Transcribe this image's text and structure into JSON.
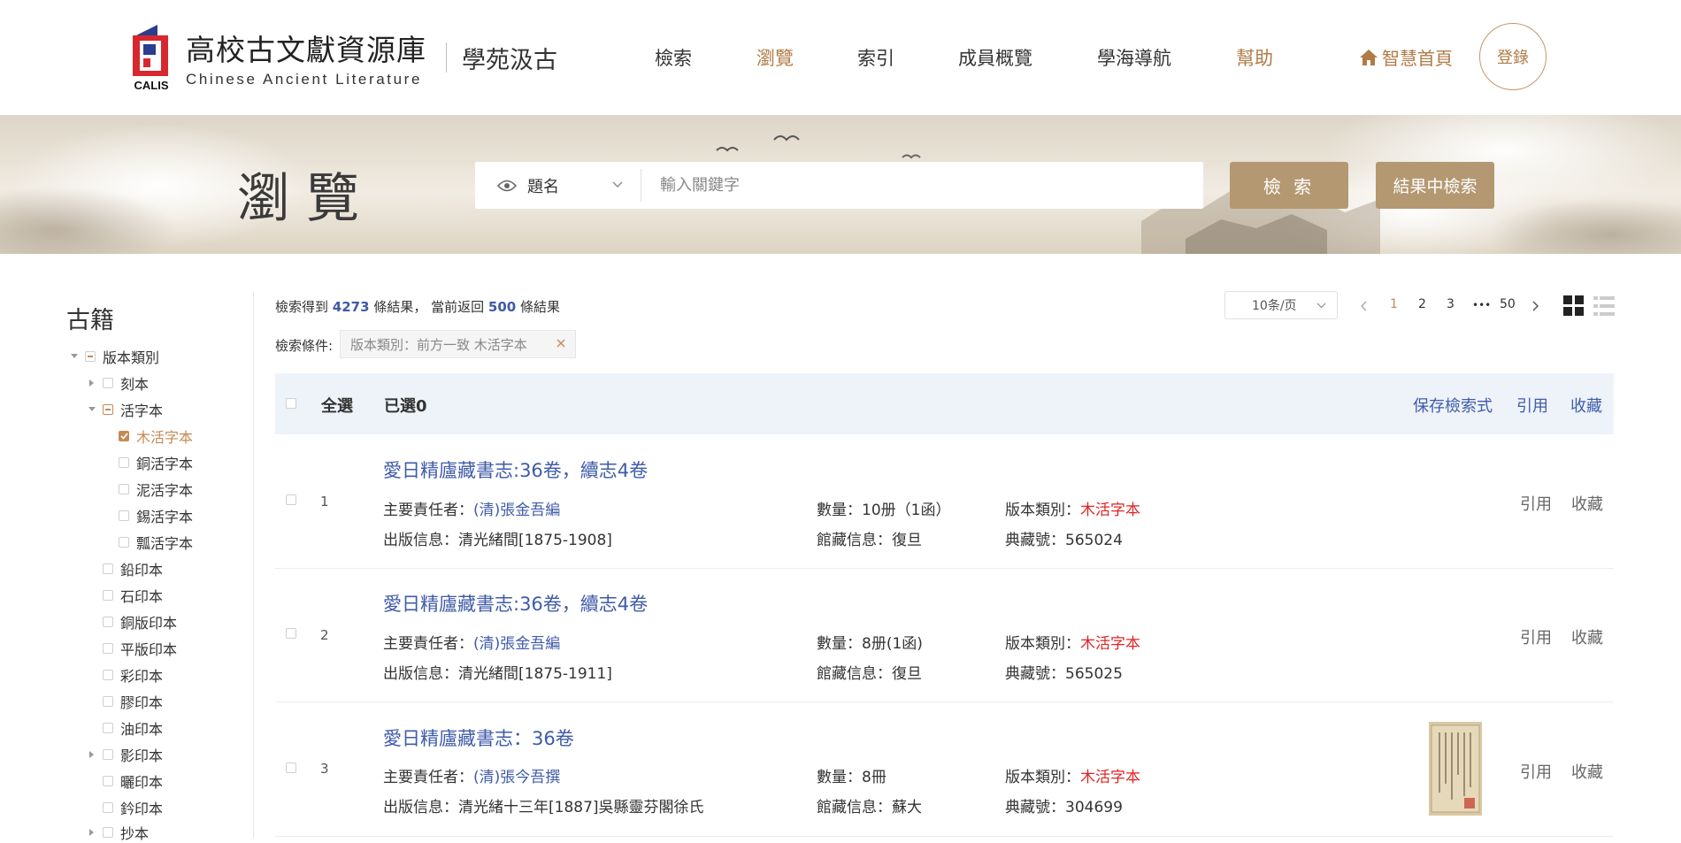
{
  "header": {
    "logo_badge": "CALIS",
    "site_name_cn": "高校古文獻資源庫",
    "site_name_en": "Chinese Ancient Literature",
    "sub_brand": "學苑汲古",
    "nav": [
      "檢索",
      "瀏覽",
      "索引",
      "成員概覽",
      "學海導航",
      "幫助"
    ],
    "home_link": "智慧首頁",
    "login": "登錄",
    "accent": "#b07b45"
  },
  "banner": {
    "title": "瀏覽",
    "search_field": "題名",
    "search_placeholder": "輸入關鍵字",
    "search_button": "檢 索",
    "refine_button": "結果中檢索"
  },
  "sidebar": {
    "title": "古籍",
    "tree": [
      {
        "label": "版本類別",
        "state": "partial"
      },
      {
        "label": "刻本",
        "state": "none"
      },
      {
        "label": "活字本",
        "state": "partial"
      },
      {
        "label": "木活字本",
        "state": "checked"
      },
      {
        "label": "銅活字本",
        "state": "none"
      },
      {
        "label": "泥活字本",
        "state": "none"
      },
      {
        "label": "錫活字本",
        "state": "none"
      },
      {
        "label": "瓢活字本",
        "state": "none"
      },
      {
        "label": "鉛印本",
        "state": "none"
      },
      {
        "label": "石印本",
        "state": "none"
      },
      {
        "label": "銅版印本",
        "state": "none"
      },
      {
        "label": "平版印本",
        "state": "none"
      },
      {
        "label": "彩印本",
        "state": "none"
      },
      {
        "label": "膠印本",
        "state": "none"
      },
      {
        "label": "油印本",
        "state": "none"
      },
      {
        "label": "影印本",
        "state": "none"
      },
      {
        "label": "曬印本",
        "state": "none"
      },
      {
        "label": "鈐印本",
        "state": "none"
      },
      {
        "label": "抄本",
        "state": "none"
      }
    ]
  },
  "results": {
    "summary_prefix": "檢索得到",
    "total": "4273",
    "summary_mid": "條結果， 當前返回",
    "returned": "500",
    "summary_suffix": "條結果",
    "per_page": "10条/页",
    "pages": [
      "1",
      "2",
      "3",
      "•••",
      "50"
    ],
    "current_page": "1",
    "condition_label": "檢索條件:",
    "condition_tag": "版本類別：前方一致 木活字本",
    "select_all": "全選",
    "selected": "已選0",
    "actions": [
      "保存檢索式",
      "引用",
      "收藏"
    ],
    "labels": {
      "author": "主要責任者：",
      "publish": "出版信息：",
      "quantity": "數量：",
      "holding": "館藏信息：",
      "edition": "版本類別：",
      "callno": "典藏號："
    },
    "row_actions": [
      "引用",
      "收藏"
    ],
    "rows": [
      {
        "index": "1",
        "title": "愛日精廬藏書志:36卷，續志4卷",
        "author": "(清)張金吾編",
        "publish": "清光緒間[1875-1908]",
        "quantity": "10册（1函）",
        "holding": "復旦",
        "edition": "木活字本",
        "callno": "565024"
      },
      {
        "index": "2",
        "title": "愛日精廬藏書志:36卷，續志4卷",
        "author": "(清)張金吾編",
        "publish": "清光緒間[1875-1911]",
        "quantity": "8册(1函)",
        "holding": "復旦",
        "edition": "木活字本",
        "callno": "565025"
      },
      {
        "index": "3",
        "title": "愛日精廬藏書志：36卷",
        "author": "(清)張今吾撰",
        "publish": "清光緒十三年[1887]吳縣靈芬閣徐氏",
        "quantity": "8冊",
        "holding": "蘇大",
        "edition": "木活字本",
        "callno": "304699"
      }
    ]
  }
}
